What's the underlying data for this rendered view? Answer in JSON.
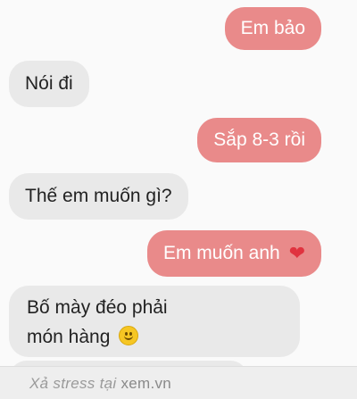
{
  "messages": [
    {
      "side": "sent",
      "text": "Em bảo"
    },
    {
      "side": "received",
      "text": "Nói đi"
    },
    {
      "side": "sent",
      "text": "Sắp 8-3 rồi"
    },
    {
      "side": "received",
      "text": "Thế em muốn gì?"
    },
    {
      "side": "sent",
      "text": "Em muốn anh",
      "emoji": "heart-icon"
    },
    {
      "side": "received",
      "line1": "Bố mày đéo phải",
      "line2": "món hàng",
      "emoji": "smile-icon"
    }
  ],
  "watermark": {
    "prefix": "Xả stress tại ",
    "site": "xem.vn"
  },
  "colors": {
    "sent_bubble": "#e98a8a",
    "received_bubble": "#e9e9e9",
    "heart": "#e0333f"
  }
}
